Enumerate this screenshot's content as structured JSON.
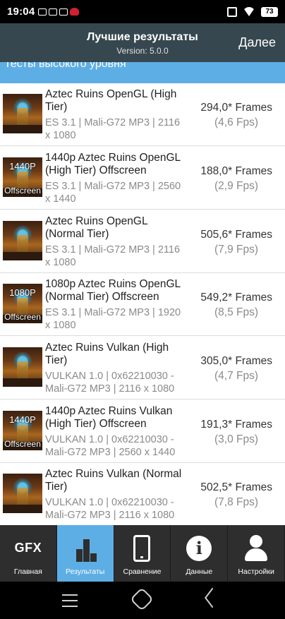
{
  "status_bar": {
    "time": "19:04",
    "battery": "73"
  },
  "header": {
    "title": "Лучшие результаты",
    "subtitle": "Version: 5.0.0",
    "next_label": "Далее"
  },
  "section": {
    "title": "Тесты высокого уровня"
  },
  "results": [
    {
      "title": "Aztec Ruins OpenGL (High Tier)",
      "meta": "ES 3.1 | Mali-G72 MP3 | 2116 x 1080",
      "frames": "294,0* Frames",
      "fps": "(4,6 Fps)",
      "thumb_top": "",
      "thumb_bottom": ""
    },
    {
      "title": "1440p Aztec Ruins OpenGL (High Tier) Offscreen",
      "meta": "ES 3.1 | Mali-G72 MP3 | 2560 x 1440",
      "frames": "188,0* Frames",
      "fps": "(2,9 Fps)",
      "thumb_top": "1440P",
      "thumb_bottom": "Offscreen"
    },
    {
      "title": "Aztec Ruins OpenGL (Normal Tier)",
      "meta": "ES 3.1 | Mali-G72 MP3 | 2116 x 1080",
      "frames": "505,6* Frames",
      "fps": "(7,9 Fps)",
      "thumb_top": "",
      "thumb_bottom": ""
    },
    {
      "title": "1080p Aztec Ruins OpenGL (Normal Tier) Offscreen",
      "meta": "ES 3.1 | Mali-G72 MP3 | 1920 x 1080",
      "frames": "549,2* Frames",
      "fps": "(8,5 Fps)",
      "thumb_top": "1080P",
      "thumb_bottom": "Offscreen"
    },
    {
      "title": "Aztec Ruins Vulkan (High Tier)",
      "meta": "VULKAN 1.0 | 0x62210030 - Mali-G72 MP3 | 2116 x 1080",
      "frames": "305,0* Frames",
      "fps": "(4,7 Fps)",
      "thumb_top": "",
      "thumb_bottom": ""
    },
    {
      "title": "1440p Aztec Ruins Vulkan (High Tier) Offscreen",
      "meta": "VULKAN 1.0 | 0x62210030 - Mali-G72 MP3 | 2560 x 1440",
      "frames": "191,3* Frames",
      "fps": "(3,0 Fps)",
      "thumb_top": "1440P",
      "thumb_bottom": "Offscreen"
    },
    {
      "title": "Aztec Ruins Vulkan (Normal Tier)",
      "meta": "VULKAN 1.0 | 0x62210030 - Mali-G72 MP3 | 2116 x 1080",
      "frames": "502,5* Frames",
      "fps": "(7,8 Fps)",
      "thumb_top": "",
      "thumb_bottom": ""
    }
  ],
  "tabs": [
    {
      "label": "Главная",
      "icon": "gfx-logo-icon",
      "icon_text": "GFX"
    },
    {
      "label": "Результаты",
      "icon": "bar-chart-icon",
      "active": true
    },
    {
      "label": "Сравнение",
      "icon": "phone-icon"
    },
    {
      "label": "Данные",
      "icon": "info-icon",
      "icon_text": "i"
    },
    {
      "label": "Настройки",
      "icon": "user-icon"
    }
  ],
  "colors": {
    "header_bg": "#37474f",
    "accent": "#5eaee6",
    "tabbar_bg": "#2e2e2e"
  }
}
